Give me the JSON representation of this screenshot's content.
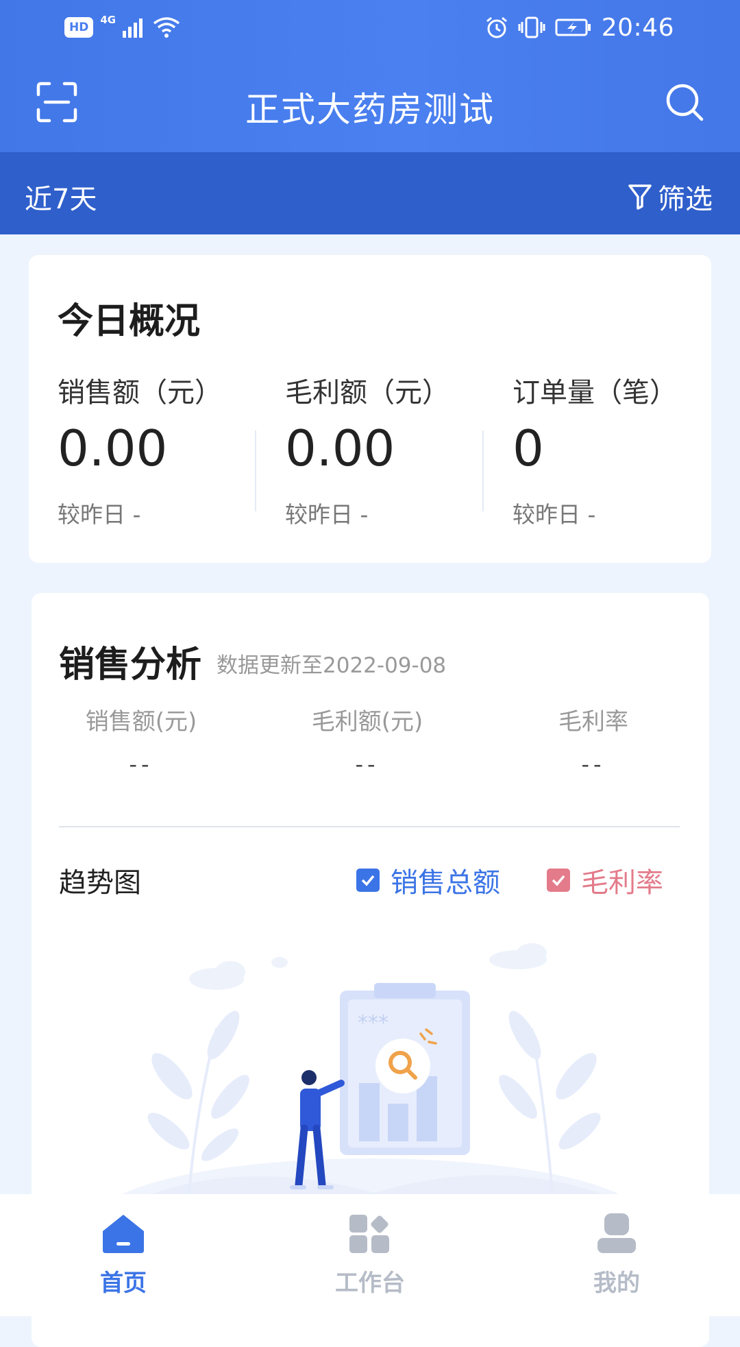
{
  "status_bar": {
    "network_badge": "HD",
    "network_type": "4G",
    "time": "20:46"
  },
  "header": {
    "title": "正式大药房测试"
  },
  "filter_bar": {
    "range": "近7天",
    "filter_label": "筛选"
  },
  "today_overview": {
    "title": "今日概况",
    "metrics": [
      {
        "label": "销售额（元）",
        "value": "0.00",
        "compare": "较昨日 -"
      },
      {
        "label": "毛利额（元）",
        "value": "0.00",
        "compare": "较昨日 -"
      },
      {
        "label": "订单量（笔）",
        "value": "0",
        "compare": "较昨日 -"
      }
    ]
  },
  "sales_analysis": {
    "title": "销售分析",
    "subtitle": "数据更新至2022-09-08",
    "stats": [
      {
        "label": "销售额(元)",
        "value": "--"
      },
      {
        "label": "毛利额(元)",
        "value": "--"
      },
      {
        "label": "毛利率",
        "value": "--"
      }
    ],
    "trend_title": "趋势图",
    "legend": [
      {
        "label": "销售总额",
        "checked": true,
        "color": "#3b74e6"
      },
      {
        "label": "毛利率",
        "checked": true,
        "color": "#e37b8a"
      }
    ]
  },
  "tabs": [
    {
      "label": "首页",
      "icon": "home-icon",
      "active": true
    },
    {
      "label": "工作台",
      "icon": "apps-icon",
      "active": false
    },
    {
      "label": "我的",
      "icon": "user-icon",
      "active": false
    }
  ],
  "colors": {
    "primary": "#4a7ef0",
    "filter_bar": "#2f5fcb",
    "background": "#eef4fd",
    "active_tab": "#3b74e6",
    "inactive_tab": "#b5bcc7"
  }
}
